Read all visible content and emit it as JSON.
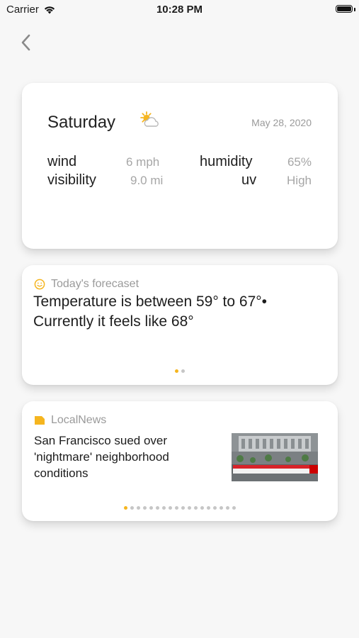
{
  "status_bar": {
    "carrier": "Carrier",
    "time": "10:28 PM"
  },
  "weather": {
    "day": "Saturday",
    "date": "May 28, 2020",
    "icon": "partly-sunny-icon",
    "wind": {
      "label": "wind",
      "value": "6 mph"
    },
    "humidity": {
      "label": "humidity",
      "value": "65%"
    },
    "visibility": {
      "label": "visibility",
      "value": "9.0 mi"
    },
    "uv": {
      "label": "uv",
      "value": "High"
    }
  },
  "forecast": {
    "header": "Today's forecaset",
    "line1": "Temperature is between 59° to 67°•",
    "line2": "Currently it feels like 68°",
    "page_count": 2,
    "active_page": 0
  },
  "news": {
    "header": "LocalNews",
    "headline": "San Francisco sued over 'nightmare' neighborhood conditions",
    "page_count": 18,
    "active_page": 0
  },
  "colors": {
    "accent": "#f5b51f",
    "muted": "#9a9a9a",
    "background": "#f7f7f7"
  }
}
